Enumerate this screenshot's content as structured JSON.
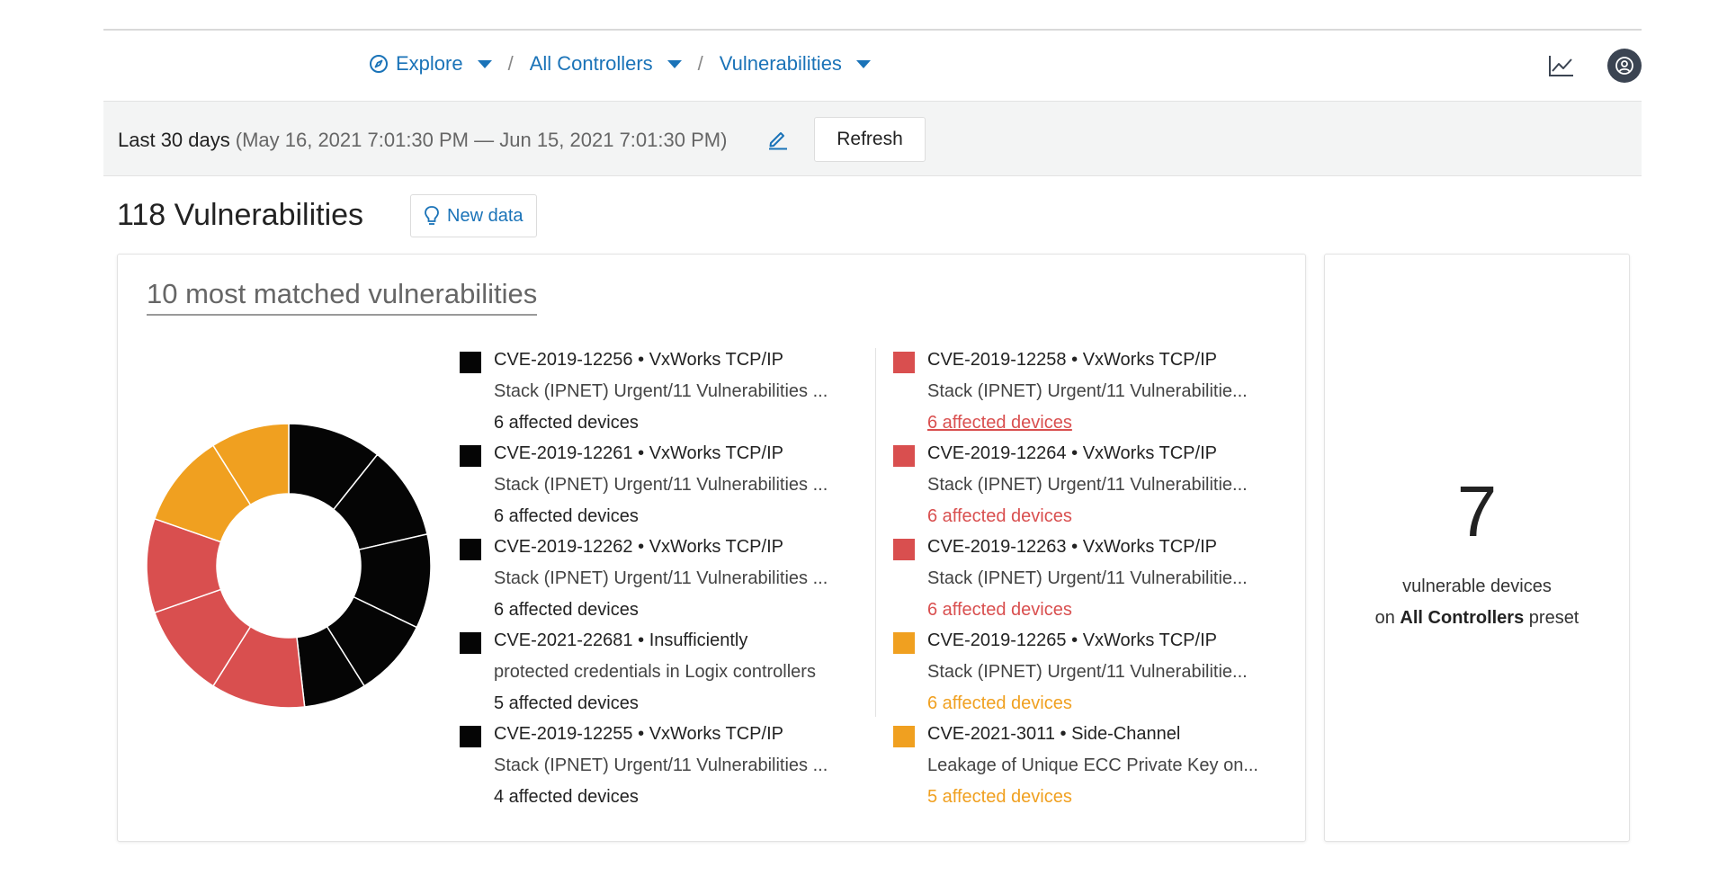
{
  "nav": {
    "breadcrumbs": [
      {
        "label": "Explore"
      },
      {
        "label": "All Controllers"
      },
      {
        "label": "Vulnerabilities"
      }
    ],
    "separator": "/"
  },
  "timebar": {
    "preset": "Last 30 days",
    "range": "(May 16, 2021 7:01:30 PM — Jun 15, 2021 7:01:30 PM)",
    "refresh_label": "Refresh"
  },
  "heading": {
    "title": "118 Vulnerabilities",
    "new_data_label": "New data"
  },
  "top_vulns": {
    "title": "10 most matched vulnerabilities",
    "items": [
      {
        "id": "CVE-2019-12256",
        "name": "VxWorks TCP/IP",
        "desc": "Stack (IPNET) Urgent/11 Vulnerabilities ...",
        "count": "6 affected devices",
        "color": "#050505"
      },
      {
        "id": "CVE-2019-12261",
        "name": "VxWorks TCP/IP",
        "desc": "Stack (IPNET) Urgent/11 Vulnerabilities ...",
        "count": "6 affected devices",
        "color": "#050505"
      },
      {
        "id": "CVE-2019-12262",
        "name": "VxWorks TCP/IP",
        "desc": "Stack (IPNET) Urgent/11 Vulnerabilities ...",
        "count": "6 affected devices",
        "color": "#050505"
      },
      {
        "id": "CVE-2021-22681",
        "name": "Insufficiently",
        "desc": "protected credentials in Logix controllers",
        "count": "5 affected devices",
        "color": "#050505"
      },
      {
        "id": "CVE-2019-12255",
        "name": "VxWorks TCP/IP",
        "desc": "Stack (IPNET) Urgent/11 Vulnerabilities ...",
        "count": "4 affected devices",
        "color": "#050505"
      },
      {
        "id": "CVE-2019-12258",
        "name": "VxWorks TCP/IP",
        "desc": "Stack (IPNET) Urgent/11 Vulnerabilitie...",
        "count": "6 affected devices",
        "color": "#d94f4f"
      },
      {
        "id": "CVE-2019-12264",
        "name": "VxWorks TCP/IP",
        "desc": "Stack (IPNET) Urgent/11 Vulnerabilitie...",
        "count": "6 affected devices",
        "color": "#d94f4f"
      },
      {
        "id": "CVE-2019-12263",
        "name": "VxWorks TCP/IP",
        "desc": "Stack (IPNET) Urgent/11 Vulnerabilitie...",
        "count": "6 affected devices",
        "color": "#d94f4f"
      },
      {
        "id": "CVE-2019-12265",
        "name": "VxWorks TCP/IP",
        "desc": "Stack (IPNET) Urgent/11 Vulnerabilitie...",
        "count": "6 affected devices",
        "color": "#f0a020"
      },
      {
        "id": "CVE-2021-3011",
        "name": "Side-Channel",
        "desc": "Leakage of Unique ECC Private Key on...",
        "count": "5 affected devices",
        "color": "#f0a020"
      }
    ]
  },
  "chart_data": {
    "type": "pie",
    "categories": [
      "CVE-2019-12256",
      "CVE-2019-12261",
      "CVE-2019-12262",
      "CVE-2021-22681",
      "CVE-2019-12255",
      "CVE-2019-12258",
      "CVE-2019-12264",
      "CVE-2019-12263",
      "CVE-2019-12265",
      "CVE-2021-3011"
    ],
    "values": [
      6,
      6,
      6,
      5,
      4,
      6,
      6,
      6,
      6,
      5
    ],
    "colors": [
      "#050505",
      "#050505",
      "#050505",
      "#050505",
      "#050505",
      "#d94f4f",
      "#d94f4f",
      "#d94f4f",
      "#f0a020",
      "#f0a020"
    ],
    "donut": true,
    "legend": "right"
  },
  "side": {
    "count": "7",
    "label": "vulnerable devices",
    "preset_prefix": "on",
    "preset_name": "All Controllers",
    "preset_suffix": "preset"
  },
  "colors": {
    "accent": "#1a73b8",
    "black_series": "#050505",
    "red_series": "#d94f4f",
    "orange_series": "#f0a020"
  }
}
